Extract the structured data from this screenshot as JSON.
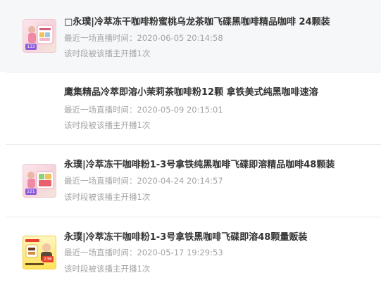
{
  "products": [
    {
      "title": "□永璞|冷萃冻干咖啡粉蜜桃乌龙茶咖飞碟黑咖啡精品咖啡 24颗装",
      "last_live": "最近一场直播时间：2020-06-05 20:14:58",
      "count": "该时段被该播主开播1次",
      "has_thumb": true,
      "thumb_theme": "pink",
      "rank": "133",
      "rank_color": "#8a5ad8"
    },
    {
      "title": "鹰集精品冷萃即溶小茉莉茶咖啡粉12颗 拿铁美式纯黑咖啡速溶",
      "last_live": "最近一场直播时间：2020-05-09 20:15:01",
      "count": "该时段被该播主开播1次",
      "has_thumb": false
    },
    {
      "title": "永璞|冷萃冻干咖啡粉1-3号拿铁纯黑咖啡飞碟即溶精品咖啡48颗装",
      "last_live": "最近一场直播时间：2020-04-24 20:14:57",
      "count": "该时段被该播主开播1次",
      "has_thumb": true,
      "thumb_theme": "pink",
      "rank": "221",
      "rank_color": "#8a5ad8"
    },
    {
      "title": "永璞|冷萃冻干咖啡粉1-3号拿铁黑咖啡飞碟即溶48颗量贩装",
      "last_live": "最近一场直播时间：2020-05-17 19:29:53",
      "count": "该时段被该播主开播1次",
      "has_thumb": true,
      "thumb_theme": "yellow",
      "rank": "236",
      "rank_color": "#e8402a"
    }
  ],
  "colors": {
    "title": "#333333",
    "meta": "#a3a3a3",
    "row_shade": "#f6f7f9",
    "divider": "#ebebeb"
  }
}
